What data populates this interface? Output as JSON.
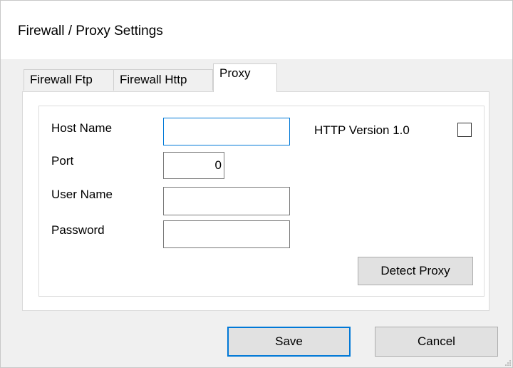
{
  "window": {
    "title": "Firewall / Proxy Settings"
  },
  "tabs": [
    {
      "label": "Firewall Ftp",
      "active": false
    },
    {
      "label": "Firewall Http",
      "active": false
    },
    {
      "label": "Proxy",
      "active": true
    }
  ],
  "proxy": {
    "host_name_label": "Host Name",
    "host_name_value": "",
    "port_label": "Port",
    "port_value": "0",
    "user_name_label": "User Name",
    "user_name_value": "",
    "password_label": "Password",
    "password_value": "",
    "http_version_label": "HTTP Version 1.0",
    "http_version_checked": false,
    "detect_proxy_label": "Detect Proxy"
  },
  "footer": {
    "save_label": "Save",
    "cancel_label": "Cancel"
  },
  "colors": {
    "focus_border": "#0078d7",
    "button_face": "#e1e1e1",
    "window_bg": "#f0f0f0"
  }
}
